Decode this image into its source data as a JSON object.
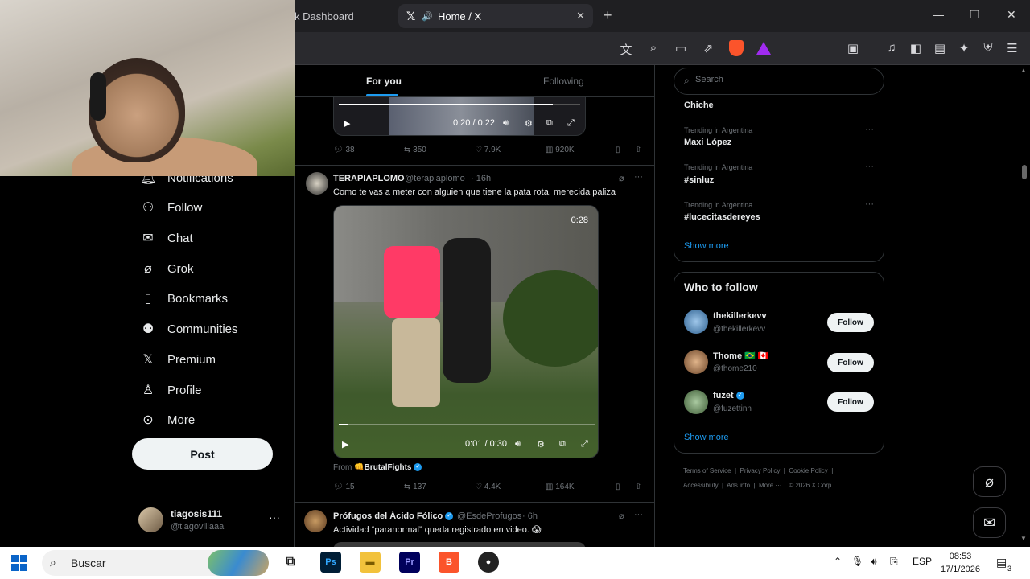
{
  "browser": {
    "prev_tab_title": "k Dashboard",
    "active_tab_title": "Home / X",
    "new_tab_symbol": "+"
  },
  "nav": {
    "items": [
      {
        "label": "Notifications",
        "icon": "bell-icon"
      },
      {
        "label": "Follow",
        "icon": "add-person-icon"
      },
      {
        "label": "Chat",
        "icon": "mail-icon"
      },
      {
        "label": "Grok",
        "icon": "grok-icon"
      },
      {
        "label": "Bookmarks",
        "icon": "bookmark-icon"
      },
      {
        "label": "Communities",
        "icon": "communities-icon"
      },
      {
        "label": "Premium",
        "icon": "x-logo-icon"
      },
      {
        "label": "Profile",
        "icon": "person-icon"
      },
      {
        "label": "More",
        "icon": "more-icon"
      }
    ],
    "post_label": "Post",
    "profile_name": "tiagosis111",
    "profile_handle": "@tiagovillaaa"
  },
  "feed": {
    "tabs": [
      "For you",
      "Following"
    ],
    "top_video_time": "0:20 / 0:22",
    "top_actions": {
      "replies": "38",
      "reposts": "350",
      "likes": "7.9K",
      "views": "920K"
    },
    "tweet1": {
      "name": "TERAPIAPLOMO",
      "handle": "@terapiaplomo",
      "time": "· 16h",
      "text": "Como te vas a meter con alguien que tiene la pata rota, merecida paliza",
      "video_duration": "0:28",
      "video_time": "0:01 / 0:30",
      "from_prefix": "From",
      "from_source": "BrutalFights",
      "replies": "15",
      "reposts": "137",
      "likes": "4.4K",
      "views": "164K"
    },
    "tweet2": {
      "name": "Prófugos del Ácido Fólico",
      "handle": "@EsdeProfugos",
      "time": "· 6h",
      "text": "Actividad “paranormal” queda registrado en video. 😱"
    }
  },
  "sidebar": {
    "search_placeholder": "Search",
    "trends": [
      {
        "category": "",
        "title": "Chiche"
      },
      {
        "category": "Trending in Argentina",
        "title": "Maxi López"
      },
      {
        "category": "Trending in Argentina",
        "title": "#sinluz"
      },
      {
        "category": "Trending in Argentina",
        "title": "#lucecitasdereyes"
      }
    ],
    "show_more": "Show more",
    "who_to_follow_title": "Who to follow",
    "suggestions": [
      {
        "name": "thekillerkevv",
        "handle": "@thekillerkevv",
        "button": "Follow"
      },
      {
        "name": "Thome 🇧🇷 🇨🇦",
        "handle": "@thome210",
        "button": "Follow"
      },
      {
        "name": "fuzet",
        "handle": "@fuzettinn",
        "button": "Follow"
      }
    ],
    "footer": {
      "line1": [
        "Terms of Service",
        "Privacy Policy",
        "Cookie Policy"
      ],
      "line2": [
        "Accessibility",
        "Ads info",
        "More ···",
        "© 2026 X Corp."
      ]
    }
  },
  "taskbar": {
    "search_label": "Buscar",
    "lang": "ESP",
    "time": "08:53",
    "date": "17/1/2026",
    "notif_count": "3"
  }
}
